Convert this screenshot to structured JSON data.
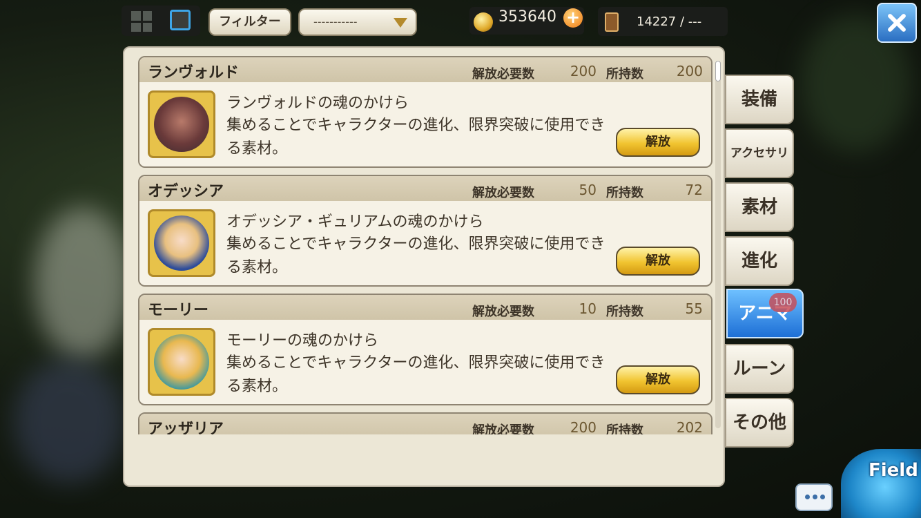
{
  "topbar": {
    "filter_label": "フィルター",
    "filter_select_value": "-----------",
    "gold_value": "353640",
    "inventory_value": "14227 / ---"
  },
  "labels": {
    "required": "解放必要数",
    "owned": "所持数",
    "release_button": "解放"
  },
  "items": [
    {
      "name": "ランヴォルド",
      "required": "200",
      "owned": "200",
      "title": "ランヴォルドの魂のかけら",
      "description": "集めることでキャラクターの進化、限界突破に使用できる素材。"
    },
    {
      "name": "オデッシア",
      "required": "50",
      "owned": "72",
      "title": "オデッシア・ギュリアムの魂のかけら",
      "description": "集めることでキャラクターの進化、限界突破に使用できる素材。"
    },
    {
      "name": "モーリー",
      "required": "10",
      "owned": "55",
      "title": "モーリーの魂のかけら",
      "description": "集めることでキャラクターの進化、限界突破に使用できる素材。"
    },
    {
      "name": "アッザリア",
      "required": "200",
      "owned": "202"
    }
  ],
  "tabs": [
    {
      "label": "装備"
    },
    {
      "label": "アクセサリ"
    },
    {
      "label": "素材"
    },
    {
      "label": "進化"
    },
    {
      "label": "アニマ",
      "badge": "100"
    },
    {
      "label": "ルーン"
    },
    {
      "label": "その他"
    }
  ],
  "field_label": "Field",
  "colors": {
    "accent_blue": "#1d6fd6",
    "button_gold": "#f1c430",
    "panel_bg": "#ece7d6"
  }
}
